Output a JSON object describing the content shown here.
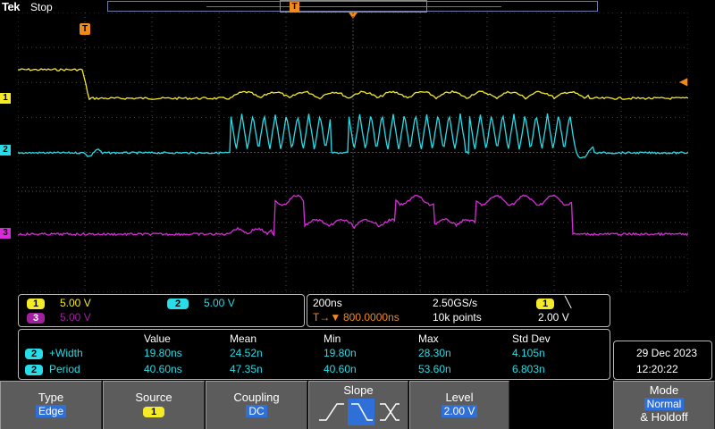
{
  "header": {
    "brand": "Tek",
    "acq_state": "Stop",
    "trigger_marker": "T"
  },
  "channels": [
    {
      "id": "1",
      "color": "#f5ea28",
      "label": "1"
    },
    {
      "id": "2",
      "color": "#26dde8",
      "label": "2"
    },
    {
      "id": "3",
      "color": "#d82cd8",
      "label": "3"
    }
  ],
  "right_marker": "◀",
  "ch_settings": {
    "ch1": {
      "num": "1",
      "scale": "5.00 V"
    },
    "ch2": {
      "num": "2",
      "scale": "5.00 V"
    },
    "ch3": {
      "num": "3",
      "scale": "5.00 V"
    }
  },
  "horizontal": {
    "timebase": "200ns",
    "sample_rate": "2.50GS/s",
    "delay_prefix": "T→▼",
    "delay": "800.0000ns",
    "record_length": "10k points",
    "trig_source": "1",
    "trig_slope_glyph": "╲",
    "trig_level": "2.00 V"
  },
  "measurements": {
    "headers": [
      "Value",
      "Mean",
      "Min",
      "Max",
      "Std Dev"
    ],
    "rows": [
      {
        "ch": "2",
        "name": "+Width",
        "value": "19.80ns",
        "mean": "24.52n",
        "min": "19.80n",
        "max": "28.30n",
        "std": "4.105n"
      },
      {
        "ch": "2",
        "name": "Period",
        "value": "40.60ns",
        "mean": "47.35n",
        "min": "40.60n",
        "max": "53.60n",
        "std": "6.803n"
      }
    ]
  },
  "datetime": {
    "date": "29 Dec  2023",
    "time": "12:20:22"
  },
  "menu": {
    "type": {
      "label": "Type",
      "value": "Edge"
    },
    "source": {
      "label": "Source",
      "value": "1"
    },
    "coupling": {
      "label": "Coupling",
      "value": "DC"
    },
    "slope": {
      "label": "Slope",
      "options": [
        "rising",
        "falling",
        "either"
      ],
      "selected": "falling"
    },
    "level": {
      "label": "Level",
      "value": "2.00 V"
    },
    "mode": {
      "label": "Mode",
      "value": "Normal",
      "suffix": "& Holdoff"
    }
  }
}
